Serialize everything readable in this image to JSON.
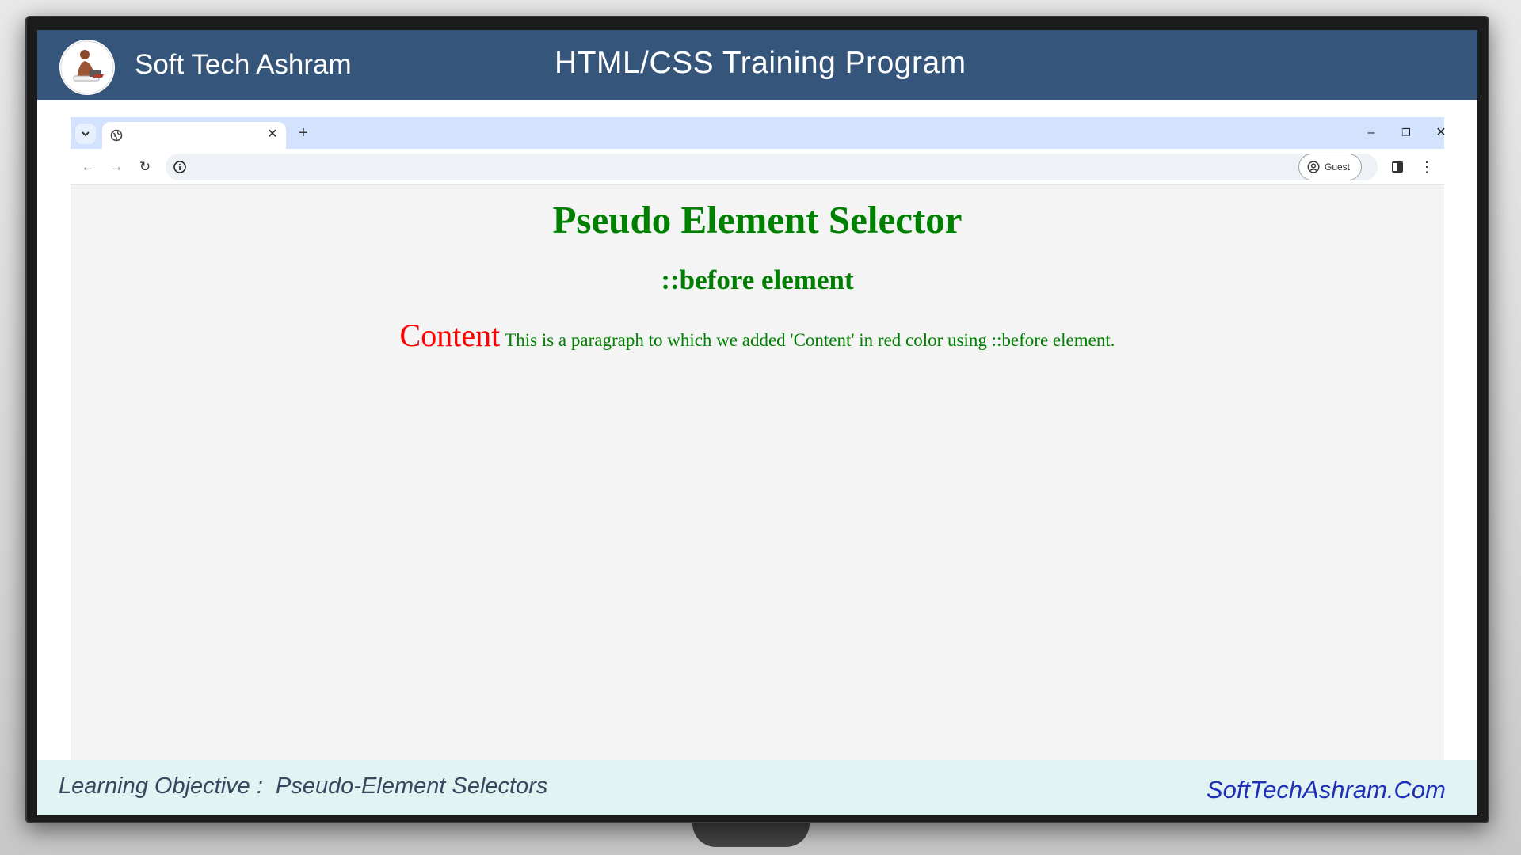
{
  "header": {
    "brand": "Soft Tech Ashram",
    "program_title": "HTML/CSS Training Program"
  },
  "browser": {
    "tab": {
      "title": "",
      "close_glyph": "✕"
    },
    "new_tab_glyph": "+",
    "window_controls": {
      "minimize": "–",
      "restore": "❐",
      "close": "✕"
    },
    "nav": {
      "back": "←",
      "forward": "→",
      "reload": "↻"
    },
    "profile_label": "Guest",
    "menu_glyph": "⋮",
    "icons": [
      "tab-dropdown-icon",
      "globe-icon",
      "site-info-icon",
      "qr-code-icon",
      "side-panel-icon",
      "profile-icon"
    ]
  },
  "page": {
    "heading": "Pseudo Element Selector",
    "subheading": "::before element",
    "before_content": "Content",
    "paragraph": "This is a paragraph to which we added 'Content' in red color using ::before element."
  },
  "footer": {
    "objective": "Learning Objective :  Pseudo-Element Selectors",
    "site": "SoftTechAshram.Com"
  },
  "colors": {
    "header_bg": "#36557a",
    "heading_green": "#008000",
    "before_red": "#ff0000",
    "footer_bg": "#e2f3f3",
    "link_blue": "#1f2fb8"
  }
}
